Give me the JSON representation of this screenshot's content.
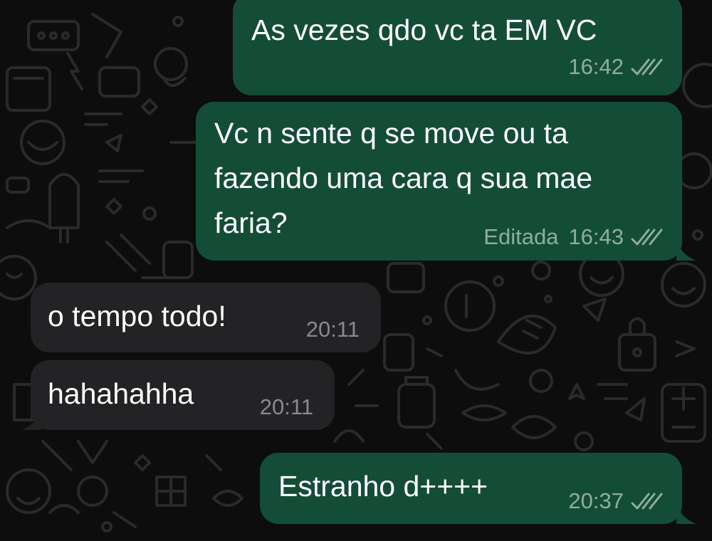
{
  "conversation": {
    "messages": [
      {
        "direction": "outgoing",
        "text": "As vezes qdo vc ta EM VC",
        "edited_label": "",
        "time": "16:42",
        "status_icon": "double-check-icon"
      },
      {
        "direction": "outgoing",
        "text_lines": [
          "Vc n sente q se move ou ta",
          "fazendo uma cara q sua mae",
          "faria?"
        ],
        "edited_label": "Editada",
        "time": "16:43",
        "status_icon": "double-check-icon"
      },
      {
        "direction": "incoming",
        "text": "o tempo todo!",
        "time": "20:11"
      },
      {
        "direction": "incoming",
        "text": "hahahahha",
        "time": "20:11"
      },
      {
        "direction": "outgoing",
        "text": "Estranho d++++",
        "edited_label": "",
        "time": "20:37",
        "status_icon": "double-check-icon"
      }
    ]
  },
  "colors": {
    "background": "#0d0d0d",
    "outgoing_bubble": "#144d37",
    "incoming_bubble": "#232325",
    "outgoing_meta": "#8fae9f",
    "incoming_meta": "#8a8a8e"
  }
}
